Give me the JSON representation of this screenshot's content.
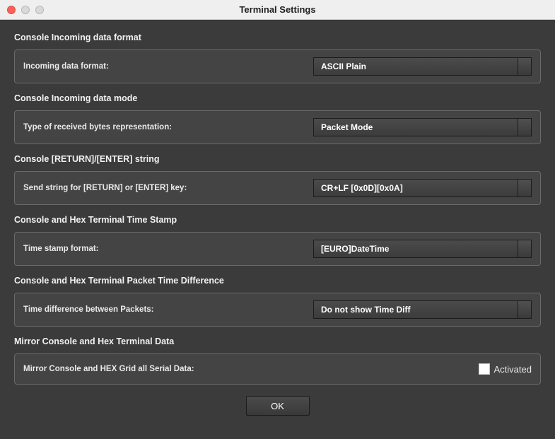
{
  "window": {
    "title": "Terminal Settings"
  },
  "sections": {
    "incoming_format": {
      "title": "Console Incoming data format",
      "label": "Incoming data format:",
      "value": "ASCII Plain"
    },
    "incoming_mode": {
      "title": "Console Incoming data mode",
      "label": "Type of received bytes representation:",
      "value": "Packet Mode"
    },
    "return_string": {
      "title": "Console [RETURN]/[ENTER] string",
      "label": "Send string for [RETURN] or [ENTER] key:",
      "value": "CR+LF [0x0D][0x0A]"
    },
    "timestamp": {
      "title": "Console and Hex Terminal Time Stamp",
      "label": "Time stamp format:",
      "value": "[EURO]DateTime"
    },
    "time_diff": {
      "title": "Console and Hex Terminal Packet Time Difference",
      "label": "Time difference between Packets:",
      "value": "Do not show Time Diff"
    },
    "mirror": {
      "title": "Mirror Console and Hex Terminal Data",
      "label": "Mirror Console and HEX Grid all Serial Data:",
      "checkbox_label": "Activated",
      "checked": false
    }
  },
  "footer": {
    "ok_label": "OK"
  }
}
